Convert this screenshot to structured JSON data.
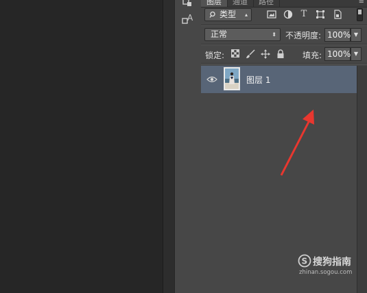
{
  "panel": {
    "tabs": [
      {
        "label": "图层",
        "active": true
      },
      {
        "label": "通道",
        "active": false
      },
      {
        "label": "路径",
        "active": false
      }
    ],
    "filter": {
      "type_label": "类型",
      "icons": [
        "image-filter-icon",
        "adjustment-filter-icon",
        "type-filter-icon",
        "shape-filter-icon",
        "smart-object-filter-icon"
      ]
    },
    "blend_mode": "正常",
    "opacity_label": "不透明度:",
    "opacity_value": "100%",
    "lock_label": "锁定:",
    "lock_icons": [
      "lock-transparent-pixels-icon",
      "lock-image-pixels-icon",
      "lock-position-icon",
      "lock-all-icon"
    ],
    "fill_label": "填充:",
    "fill_value": "100%"
  },
  "layers": [
    {
      "name": "图层 1",
      "visible": true,
      "selected": true
    }
  ],
  "watermark": {
    "title": "搜狗指南",
    "url": "zhinan.sogou.com"
  },
  "colors": {
    "selected_layer": "#586577",
    "arrow": "#e8372f",
    "panel_bg": "#474747",
    "canvas_bg": "#262626"
  }
}
